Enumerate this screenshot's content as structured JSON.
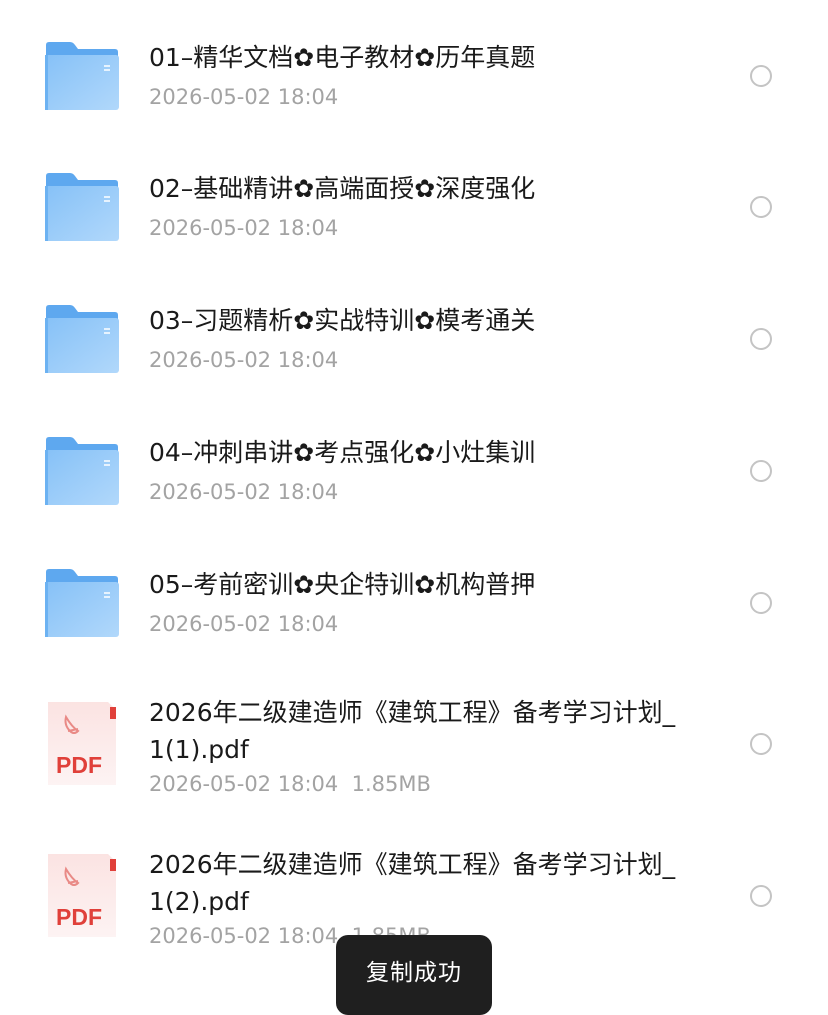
{
  "files": [
    {
      "type": "folder",
      "name": "01–精华文档✿电子教材✿历年真题",
      "meta": "2026-05-02 18:04"
    },
    {
      "type": "folder",
      "name": "02–基础精讲✿高端面授✿深度强化",
      "meta": "2026-05-02 18:04"
    },
    {
      "type": "folder",
      "name": "03–习题精析✿实战特训✿模考通关",
      "meta": "2026-05-02 18:04"
    },
    {
      "type": "folder",
      "name": "04–冲刺串讲✿考点强化✿小灶集训",
      "meta": "2026-05-02 18:04"
    },
    {
      "type": "folder",
      "name": "05–考前密训✿央企特训✿机构普押",
      "meta": "2026-05-02 18:04"
    },
    {
      "type": "pdf",
      "name": "2026年二级建造师《建筑工程》备考学习计划_1(1).pdf",
      "meta": "2026-05-02 18:04  1.85MB",
      "badge": "PDF"
    },
    {
      "type": "pdf",
      "name": "2026年二级建造师《建筑工程》备考学习计划_1(2).pdf",
      "meta": "2026-05-02 18:04  1.85MB",
      "badge": "PDF"
    }
  ],
  "toast": {
    "text": "复制成功"
  },
  "colors": {
    "folder_body": "#8cc4f6",
    "folder_tab": "#5ea8ef",
    "pdf_red": "#e0403a",
    "radio_border": "#c4c4c4",
    "meta_text": "#a3a3a3",
    "toast_bg": "#1f1f1f"
  },
  "icons": {
    "folder": "folder-icon",
    "pdf": "pdf-file-icon",
    "select": "select-radio"
  }
}
